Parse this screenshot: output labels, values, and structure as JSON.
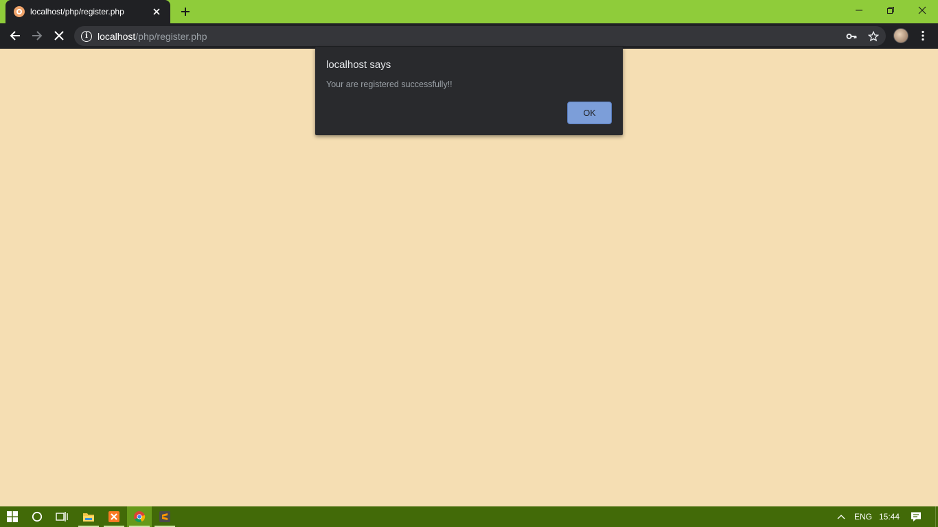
{
  "browser": {
    "tab": {
      "title": "localhost/php/register.php"
    },
    "address_bar": {
      "host": "localhost",
      "path": "/php/register.php"
    }
  },
  "dialog": {
    "title": "localhost says",
    "message": "Your are registered successfully!!",
    "ok_label": "OK"
  },
  "taskbar": {
    "language": "ENG",
    "time": "15:44"
  },
  "colors": {
    "page_background": "#f5deb3",
    "tab_strip": "#8fcc3a",
    "toolbar": "#202124",
    "dialog_background": "#292a2d",
    "ok_button": "#7c9ed9",
    "taskbar": "#426a08"
  },
  "icons": {
    "favicon": "xampp-favicon-icon",
    "tab_close": "close-icon",
    "new_tab": "plus-icon",
    "back": "arrow-left-icon",
    "forward": "arrow-right-icon",
    "stop": "stop-icon",
    "site_info": "info-icon",
    "password": "key-icon",
    "bookmark": "star-icon",
    "menu": "kebab-menu-icon"
  }
}
